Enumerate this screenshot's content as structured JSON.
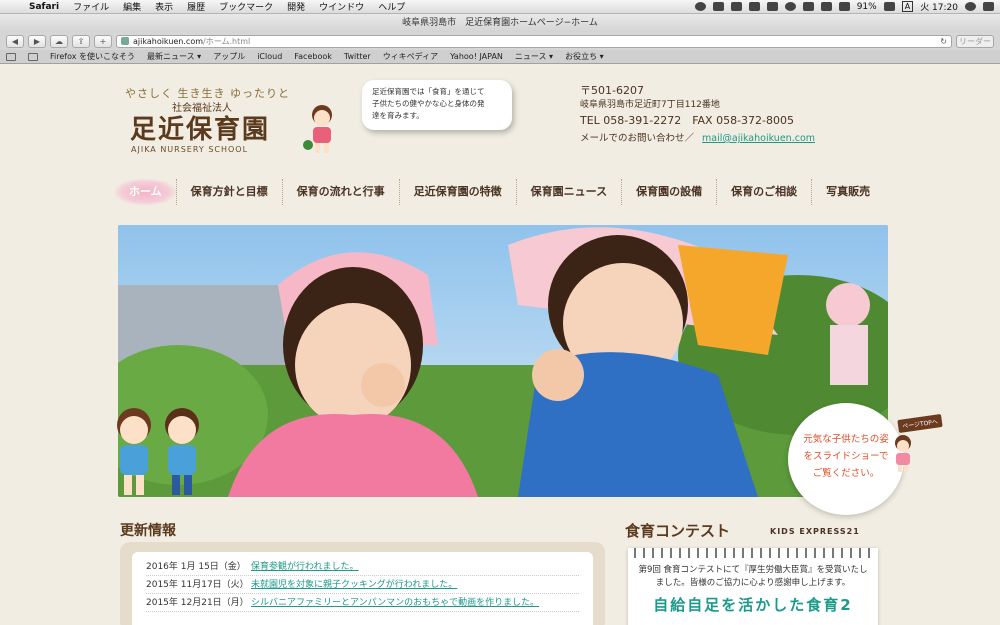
{
  "menubar": {
    "apple": "",
    "app": "Safari",
    "items": [
      "ファイル",
      "編集",
      "表示",
      "履歴",
      "ブックマーク",
      "開発",
      "ウインドウ",
      "ヘルプ"
    ],
    "battery": "91%",
    "input_mode": "A",
    "clock": "火 17:20"
  },
  "browser": {
    "window_title": "岐阜県羽島市　足近保育園ホームページ−ホーム",
    "url_host": "ajikahoikuen.com",
    "url_path": "/ホーム.html",
    "reader_label": "リーダー",
    "reload_icon": "↻",
    "bookmarks": [
      "Firefox を使いこなそう",
      "最新ニュース ▾",
      "アップル",
      "iCloud",
      "Facebook",
      "Twitter",
      "ウィキペディア",
      "Yahoo! JAPAN",
      "ニュース ▾",
      "お役立ち ▾"
    ]
  },
  "header": {
    "tagline": "やさしく 生き生き ゆったりと",
    "corp": "社会福祉法人",
    "logo": "足近保育園",
    "logo_en": "AJIKA NURSERY SCHOOL",
    "bubble_line1": "足近保育園では「食育」を通じて",
    "bubble_line2": "子供たちの健やかな心と身体の発",
    "bubble_line3": "達を育みます。"
  },
  "contact": {
    "zip": "〒501-6207",
    "address": "岐阜県羽島市足近町7丁目112番地",
    "tel": "TEL 058-391-2272",
    "fax": "FAX 058-372-8005",
    "mail_label": "メールでのお問い合わせ／",
    "mail": "mail@ajikahoikuen.com"
  },
  "nav": {
    "items": [
      "ホーム",
      "保育方針と目標",
      "保育の流れと行事",
      "足近保育園の特徴",
      "保育園ニュース",
      "保育園の設備",
      "保育のご相談",
      "写真販売"
    ]
  },
  "hero": {
    "caption_line1": "元気な子供たちの姿",
    "caption_line2": "をスライドショーで",
    "caption_line3": "ご覧ください。",
    "sign_text": "ページTOPへ"
  },
  "news": {
    "title": "更新情報",
    "rows": [
      {
        "date": "2016年 1月 15日（金）",
        "text": "保育参観が行われました。"
      },
      {
        "date": "2015年 11月17日（火）",
        "text": "未就園児を対象に親子クッキングが行われました。"
      },
      {
        "date": "2015年 12月21日（月）",
        "text": "シルバニアファミリーとアンパンマンのおもちゃで動画を作りました。"
      }
    ]
  },
  "contest": {
    "title": "食育コンテスト",
    "subtitle": "KIDS EXPRESS21",
    "line1": "第9回 食育コンテストにて『厚生労働大臣賞』を受賞いたし",
    "line2": "ました。皆様のご協力に心より感謝申し上げます。",
    "headline": "自給自足を活かした食育2"
  },
  "colors": {
    "accent_pink": "#f2b4c9",
    "link_teal": "#1b9a8a",
    "brown": "#5b3a1e",
    "caption_orange": "#e0502a"
  }
}
